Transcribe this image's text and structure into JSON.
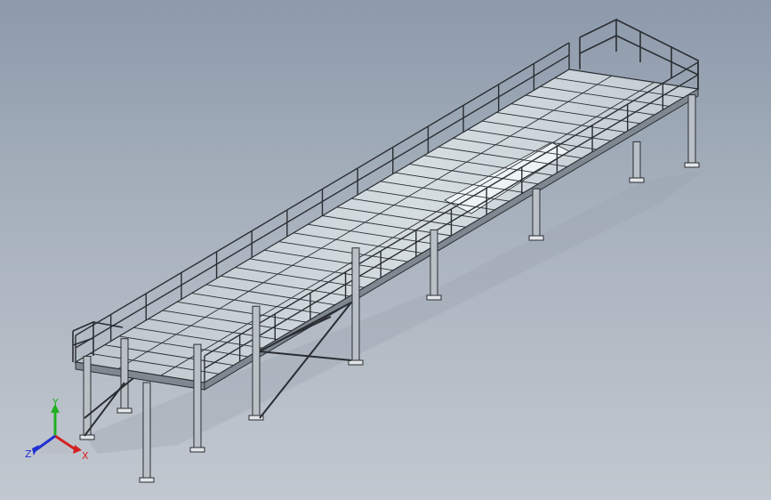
{
  "triad": {
    "x_label": "X",
    "y_label": "Y",
    "z_label": "Z",
    "x_color": "#d42020",
    "y_color": "#20b020",
    "z_color": "#2030d0"
  },
  "colors": {
    "steel_edge": "#2a2e33",
    "steel_fill": "#b9c0c6",
    "deck": "#c9d3d8",
    "deck_panel": "#e8eef0",
    "shadow": "#8a939d"
  }
}
